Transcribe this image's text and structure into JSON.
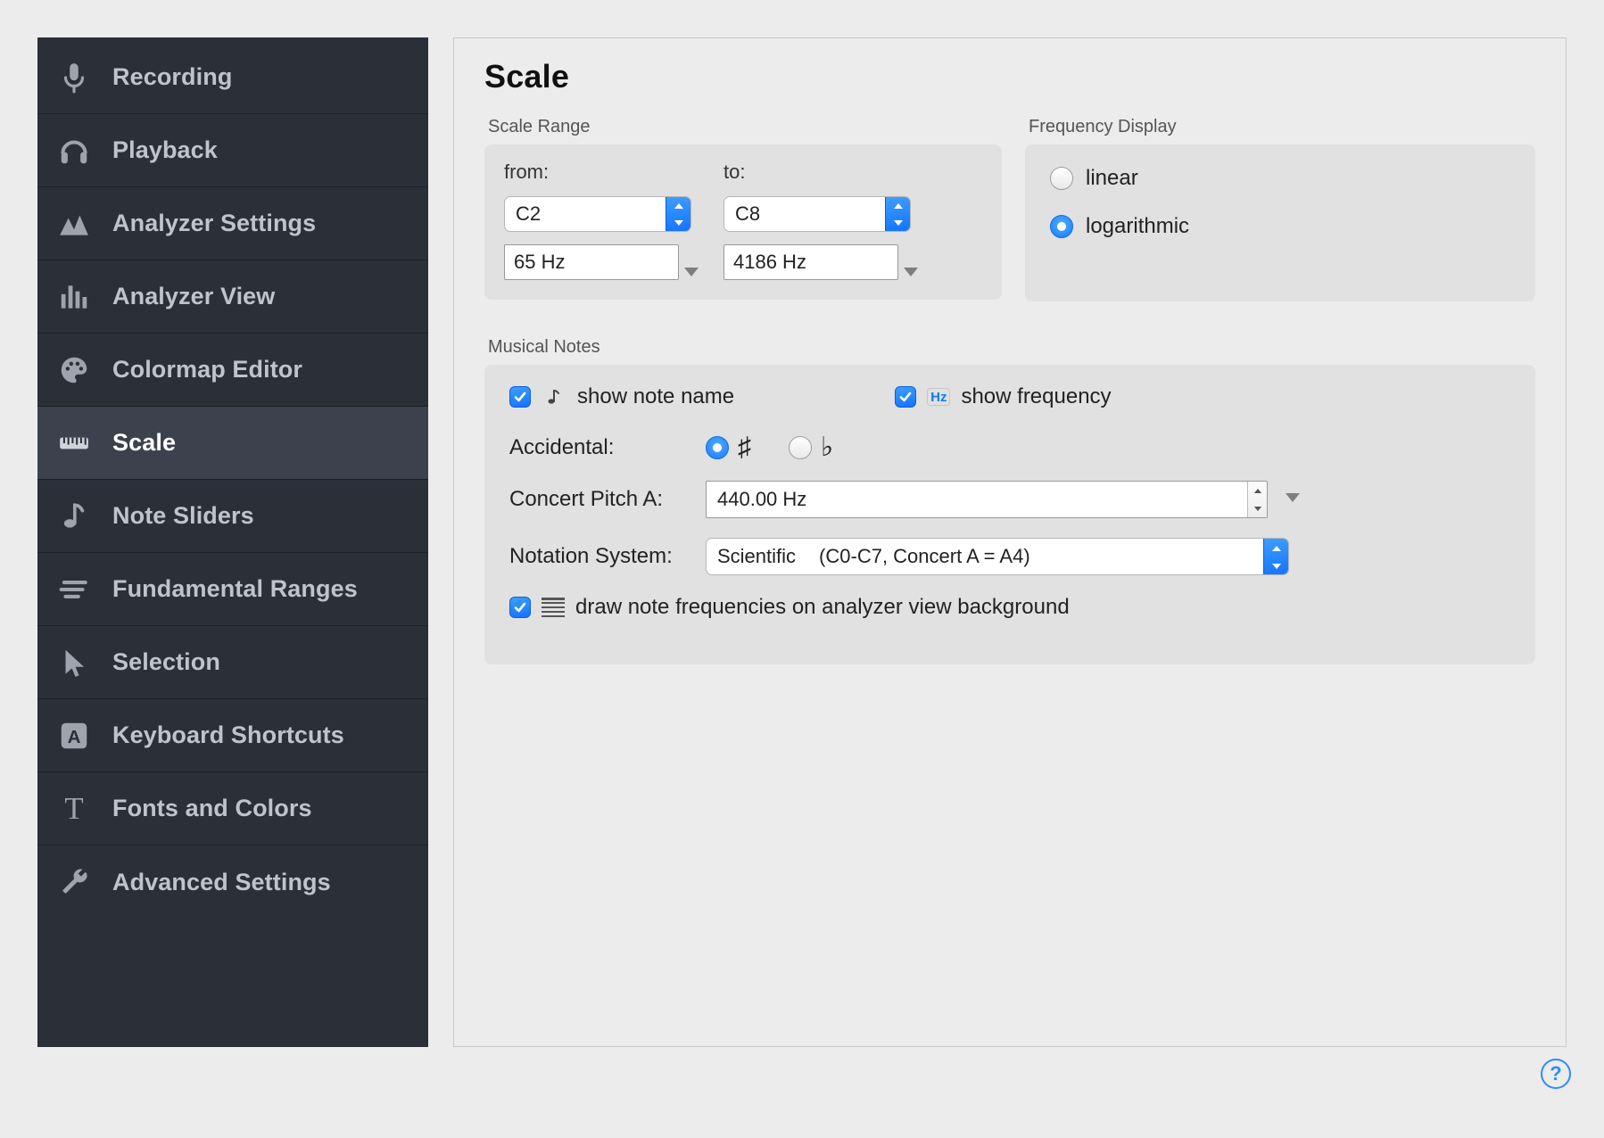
{
  "sidebar": {
    "items": [
      {
        "id": "recording",
        "label": "Recording"
      },
      {
        "id": "playback",
        "label": "Playback"
      },
      {
        "id": "analyzer-settings",
        "label": "Analyzer Settings"
      },
      {
        "id": "analyzer-view",
        "label": "Analyzer View"
      },
      {
        "id": "colormap-editor",
        "label": "Colormap Editor"
      },
      {
        "id": "scale",
        "label": "Scale"
      },
      {
        "id": "note-sliders",
        "label": "Note Sliders"
      },
      {
        "id": "fundamental-ranges",
        "label": "Fundamental Ranges"
      },
      {
        "id": "selection",
        "label": "Selection"
      },
      {
        "id": "keyboard-shortcuts",
        "label": "Keyboard Shortcuts"
      },
      {
        "id": "fonts-and-colors",
        "label": "Fonts and Colors"
      },
      {
        "id": "advanced-settings",
        "label": "Advanced Settings"
      }
    ],
    "active": "scale"
  },
  "main": {
    "title": "Scale",
    "scale_range": {
      "label": "Scale Range",
      "from_label": "from:",
      "to_label": "to:",
      "from_note": "C2",
      "to_note": "C8",
      "from_hz": "65 Hz",
      "to_hz": "4186 Hz"
    },
    "freq_display": {
      "label": "Frequency Display",
      "linear": "linear",
      "logarithmic": "logarithmic",
      "selected": "logarithmic"
    },
    "musical_notes": {
      "label": "Musical Notes",
      "show_note_name": {
        "label": "show note name",
        "checked": true
      },
      "show_frequency": {
        "label": "show frequency",
        "checked": true
      },
      "accidental_label": "Accidental:",
      "accidental_selected": "sharp",
      "sharp_symbol": "♯",
      "flat_symbol": "♭",
      "concert_pitch_label": "Concert Pitch A:",
      "concert_pitch_value": "440.00 Hz",
      "notation_label": "Notation System:",
      "notation_value_primary": "Scientific",
      "notation_value_secondary": "(C0-C7, Concert A = A4)",
      "draw_bg": {
        "label": "draw note frequencies on analyzer view background",
        "checked": true
      }
    }
  },
  "help": "?"
}
